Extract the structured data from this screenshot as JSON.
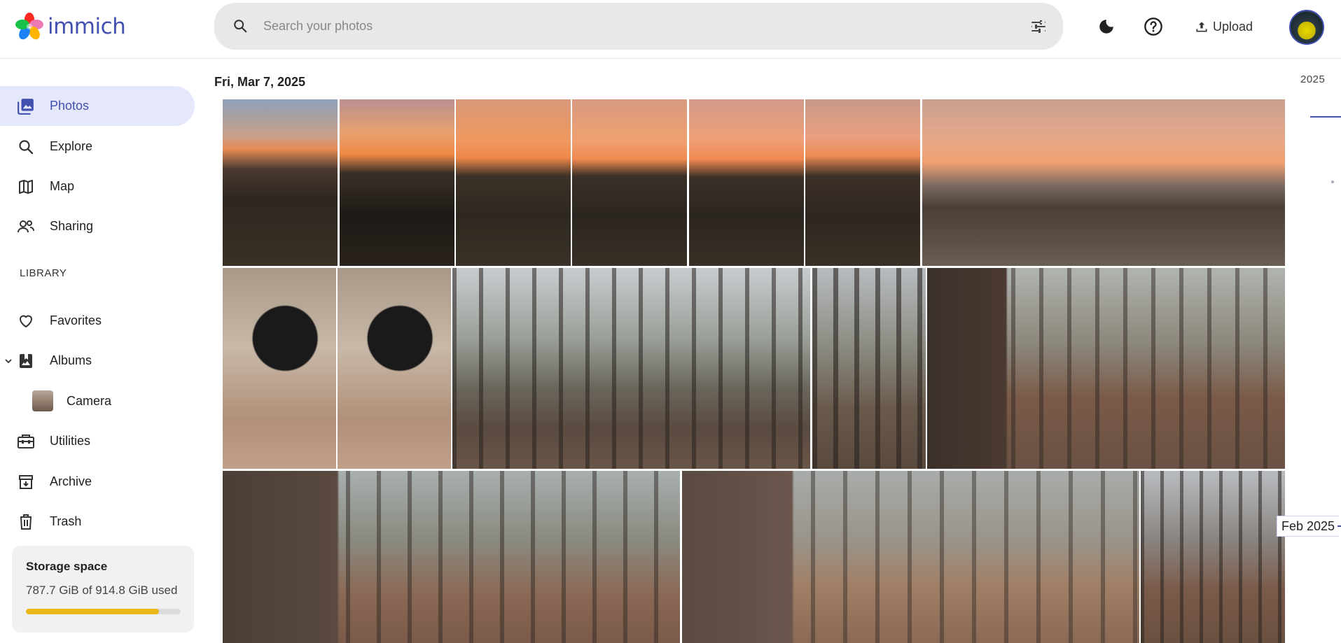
{
  "app": {
    "name": "immich"
  },
  "header": {
    "search_placeholder": "Search your photos",
    "upload_label": "Upload"
  },
  "sidebar": {
    "items": [
      {
        "label": "Photos",
        "icon": "photos-icon"
      },
      {
        "label": "Explore",
        "icon": "magnify-icon"
      },
      {
        "label": "Map",
        "icon": "map-icon"
      },
      {
        "label": "Sharing",
        "icon": "people-icon"
      }
    ],
    "library_label": "LIBRARY",
    "library_items": [
      {
        "label": "Favorites",
        "icon": "heart-icon"
      },
      {
        "label": "Albums",
        "icon": "album-icon"
      },
      {
        "label": "Camera",
        "icon": "album-thumbnail"
      },
      {
        "label": "Utilities",
        "icon": "toolbox-icon"
      },
      {
        "label": "Archive",
        "icon": "archive-icon"
      },
      {
        "label": "Trash",
        "icon": "trash-icon"
      }
    ],
    "storage": {
      "title": "Storage space",
      "usage": "787.7 GiB of 914.8 GiB used",
      "used_fraction": 0.861
    }
  },
  "timeline": {
    "date_group": "Fri, Mar 7, 2025",
    "photo_count_visible": 15
  },
  "scrubber": {
    "year": "2025",
    "hover_label": "Feb 2025"
  },
  "colors": {
    "accent": "#4250af",
    "active_bg": "#e5e8fb",
    "storage_fill": "#e8b816"
  }
}
